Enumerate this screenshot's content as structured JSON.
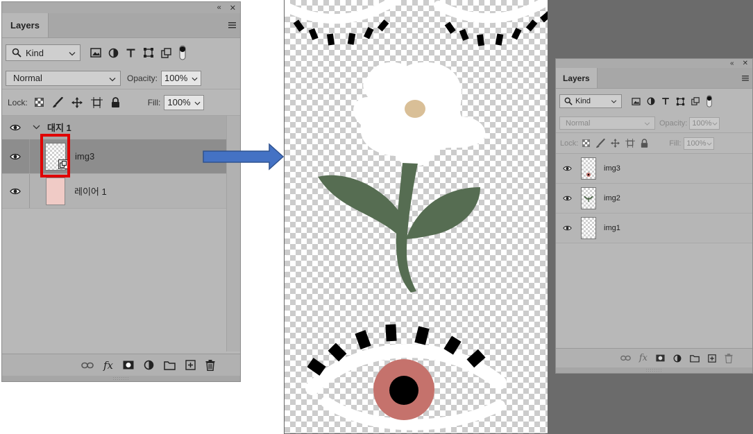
{
  "left_panel": {
    "top_controls": {
      "collapse": "«",
      "close": "✕"
    },
    "tab_label": "Layers",
    "kind_select": "Kind",
    "blend_mode": "Normal",
    "opacity_label": "Opacity:",
    "opacity_value": "100%",
    "lock_label": "Lock:",
    "fill_label": "Fill:",
    "fill_value": "100%",
    "layers": [
      {
        "name": "대지 1",
        "kind": "artboard-group",
        "expanded": true
      },
      {
        "name": "img3",
        "kind": "smart-object",
        "selected": true
      },
      {
        "name": "레이어 1",
        "kind": "color-fill",
        "color": "#f0cbc6"
      }
    ],
    "grip": "::::::::"
  },
  "right_panel": {
    "top_controls": {
      "collapse": "«",
      "close": "✕"
    },
    "tab_label": "Layers",
    "kind_select": "Kind",
    "blend_mode": "Normal",
    "opacity_label": "Opacity:",
    "opacity_value": "100%",
    "lock_label": "Lock:",
    "fill_label": "Fill:",
    "fill_value": "100%",
    "layers": [
      {
        "name": "img3"
      },
      {
        "name": "img2"
      },
      {
        "name": "img1"
      }
    ],
    "grip": "::::::::"
  },
  "colors": {
    "highlight": "#e00000",
    "arrow_fill": "#4472c4",
    "arrow_stroke": "#2f528f",
    "flower_petals": "#ffffff",
    "flower_center": "#d9bf97",
    "stem_leaves": "#566d52",
    "iris": "#c5726c",
    "pupil": "#000000",
    "lashes": "#000000"
  }
}
